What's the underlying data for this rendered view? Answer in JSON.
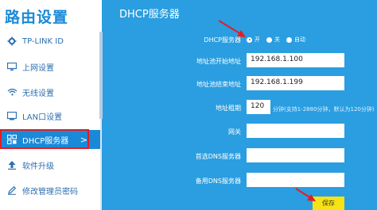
{
  "sidebar": {
    "brand": "路由设置",
    "items": [
      {
        "label": "TP-LINK ID",
        "icon": "gear-icon"
      },
      {
        "label": "上网设置",
        "icon": "monitor-icon"
      },
      {
        "label": "无线设置",
        "icon": "wifi-icon"
      },
      {
        "label": "LAN口设置",
        "icon": "lan-icon"
      },
      {
        "label": "DHCP服务器",
        "icon": "dhcp-icon",
        "active": true,
        "chevron": ">"
      },
      {
        "label": "软件升级",
        "icon": "upload-icon"
      },
      {
        "label": "修改管理员密码",
        "icon": "pencil-icon"
      }
    ]
  },
  "main": {
    "title": "DHCP服务器",
    "dhcp_label": "DHCP服务器",
    "radio_on": "开",
    "radio_off": "关",
    "radio_auto": "自动",
    "start_label": "地址池开始地址",
    "start_value": "192.168.1.100",
    "end_label": "地址池结束地址",
    "end_value": "192.168.1.199",
    "lease_label": "地址租期",
    "lease_value": "120",
    "lease_hint": "分钟(支持1-2880分钟，默认为120分钟)",
    "gateway_label": "网关",
    "gateway_value": "",
    "dns1_label": "首选DNS服务器",
    "dns1_value": "",
    "dns2_label": "备用DNS服务器",
    "dns2_value": "",
    "save_label": "保存"
  },
  "colors": {
    "background": "#2a9ee0",
    "active_nav": "#1a8ad8",
    "highlight": "#e51c23",
    "save_button": "#f7e315",
    "arrow": "#e51c23"
  }
}
